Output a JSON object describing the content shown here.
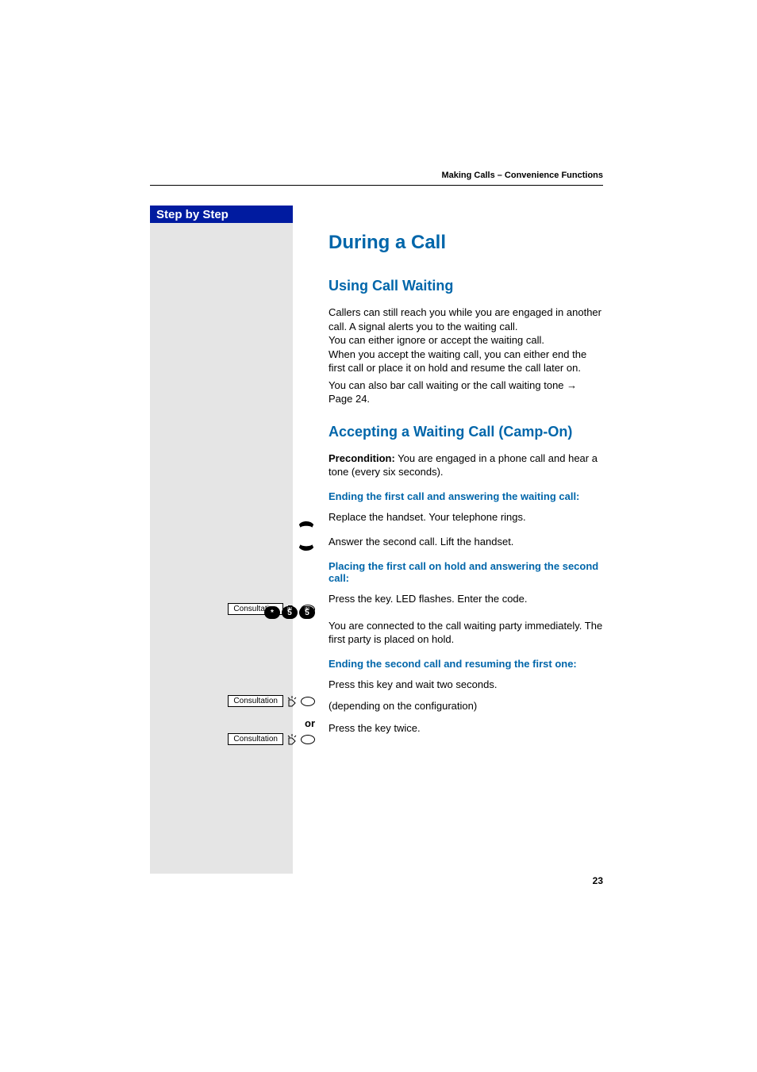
{
  "header": {
    "section_title": "Making Calls – Convenience Functions"
  },
  "sidebar": {
    "title": "Step by Step"
  },
  "gutter": {
    "consultation_label": "Consultation",
    "or_label": "or",
    "dial_keys": [
      "*",
      "5",
      "5"
    ]
  },
  "content": {
    "h1": "During a Call",
    "section1": {
      "heading": "Using Call Waiting",
      "para1": "Callers can still reach you while you are engaged in another call. A signal alerts you to the waiting call.\nYou can either ignore or accept the waiting call.\nWhen you accept the waiting call, you can either end the first call or place it on hold and resume the call later on.",
      "para2": "You can also bar call waiting or the call waiting tone → Page 24."
    },
    "section2": {
      "heading": "Accepting a Waiting Call (Camp-On)",
      "precondition_label": "Precondition:",
      "precondition_text": " You are engaged in a phone call and hear a tone (every six seconds).",
      "sub1": "Ending the first call and answering the waiting call:",
      "step1": "Replace the handset. Your telephone rings.",
      "step2": "Answer the second call. Lift the handset.",
      "sub2": "Placing the first call on hold and answering the second call:",
      "step3": "Press the key. LED flashes. Enter the code.",
      "step4": "You are connected to the call waiting party immediately. The first party is placed on hold.",
      "sub3": "Ending the second call and resuming the first one:",
      "step5": "Press this key and wait two seconds.",
      "step6": "(depending on the configuration)",
      "step7": "Press the key twice."
    }
  },
  "page_number": "23"
}
